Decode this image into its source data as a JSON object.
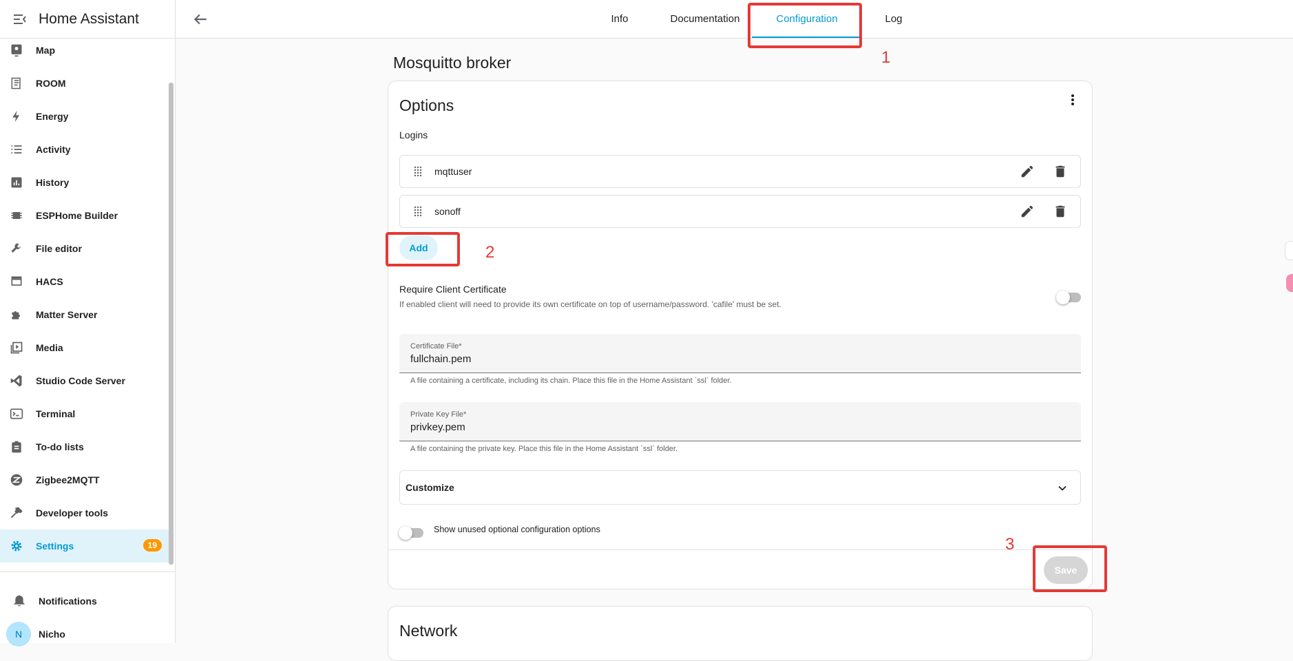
{
  "app": {
    "title": "Home Assistant"
  },
  "sidebar": {
    "items": [
      {
        "label": "Map",
        "icon": "map-icon"
      },
      {
        "label": "ROOM",
        "icon": "room-icon"
      },
      {
        "label": "Energy",
        "icon": "lightning-icon"
      },
      {
        "label": "Activity",
        "icon": "list-icon"
      },
      {
        "label": "History",
        "icon": "chart-icon"
      },
      {
        "label": "ESPHome Builder",
        "icon": "chip-icon"
      },
      {
        "label": "File editor",
        "icon": "wrench-icon"
      },
      {
        "label": "HACS",
        "icon": "hacs-icon"
      },
      {
        "label": "Matter Server",
        "icon": "puzzle-icon"
      },
      {
        "label": "Media",
        "icon": "media-icon"
      },
      {
        "label": "Studio Code Server",
        "icon": "vscode-icon"
      },
      {
        "label": "Terminal",
        "icon": "terminal-icon"
      },
      {
        "label": "To-do lists",
        "icon": "clipboard-icon"
      },
      {
        "label": "Zigbee2MQTT",
        "icon": "zigbee-icon"
      },
      {
        "label": "Developer tools",
        "icon": "hammer-icon"
      },
      {
        "label": "Settings",
        "icon": "gear-icon",
        "badge": "19",
        "active": true
      }
    ],
    "notifications": "Notifications",
    "user": {
      "initial": "N",
      "name": "Nicho"
    }
  },
  "tabs": [
    {
      "label": "Info"
    },
    {
      "label": "Documentation"
    },
    {
      "label": "Configuration",
      "active": true
    },
    {
      "label": "Log"
    }
  ],
  "page": {
    "title": "Mosquitto broker",
    "options": {
      "title": "Options",
      "logins_label": "Logins",
      "logins": [
        "mqttuser",
        "sonoff"
      ],
      "add_label": "Add",
      "require_cert_title": "Require Client Certificate",
      "require_cert_desc": "If enabled client will need to provide its own certificate on top of username/password. 'cafile' must be set.",
      "cert_file_label": "Certificate File*",
      "cert_file_value": "fullchain.pem",
      "cert_file_help": "A file containing a certificate, including its chain. Place this file in the Home Assistant `ssl` folder.",
      "key_file_label": "Private Key File*",
      "key_file_value": "privkey.pem",
      "key_file_help": "A file containing the private key. Place this file in the Home Assistant `ssl` folder.",
      "customize_label": "Customize",
      "show_unused_label": "Show unused optional configuration options",
      "save_label": "Save"
    },
    "network_title": "Network"
  },
  "annotations": [
    "1",
    "2",
    "3"
  ],
  "colors": {
    "accent": "#039bd5",
    "annotation": "#e53935",
    "badge": "#ff9800"
  }
}
